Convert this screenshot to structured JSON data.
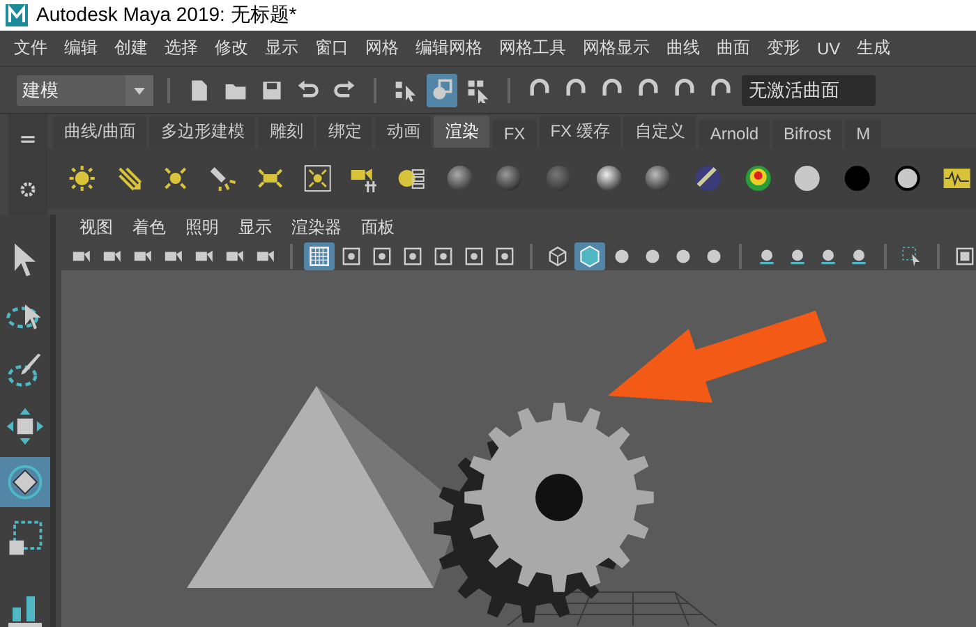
{
  "window": {
    "title": "Autodesk Maya 2019: 无标题*"
  },
  "menu_bar": [
    "文件",
    "编辑",
    "创建",
    "选择",
    "修改",
    "显示",
    "窗口",
    "网格",
    "编辑网格",
    "网格工具",
    "网格显示",
    "曲线",
    "曲面",
    "变形",
    "UV",
    "生成"
  ],
  "status_line": {
    "mode": {
      "value": "建模"
    },
    "select_tools": [
      {
        "kind": "hierarchy",
        "selected": false
      },
      {
        "kind": "object",
        "selected": true
      },
      {
        "kind": "component",
        "selected": false
      }
    ],
    "live_surface": {
      "value": "无激活曲面"
    }
  },
  "shelf_tabs": [
    {
      "label": "曲线/曲面",
      "selected": false
    },
    {
      "label": "多边形建模",
      "selected": false
    },
    {
      "label": "雕刻",
      "selected": false
    },
    {
      "label": "绑定",
      "selected": false
    },
    {
      "label": "动画",
      "selected": false
    },
    {
      "label": "渲染",
      "selected": true
    },
    {
      "label": "FX",
      "selected": false
    },
    {
      "label": "FX 缓存",
      "selected": false
    },
    {
      "label": "自定义",
      "selected": false
    },
    {
      "label": "Arnold",
      "selected": false
    },
    {
      "label": "Bifrost",
      "selected": false
    },
    {
      "label": "M",
      "selected": false
    }
  ],
  "toolbox": [
    {
      "kind": "select",
      "selected": false
    },
    {
      "kind": "lasso",
      "selected": false
    },
    {
      "kind": "paint",
      "selected": false
    },
    {
      "kind": "move",
      "selected": false
    },
    {
      "kind": "rotate",
      "selected": true
    },
    {
      "kind": "scale",
      "selected": false
    }
  ],
  "panel": {
    "menu": [
      "视图",
      "着色",
      "照明",
      "显示",
      "渲染器",
      "面板"
    ],
    "toggles": [
      {
        "kind": "grid",
        "selected": true
      },
      {
        "kind": "shaded",
        "selected": true
      }
    ]
  }
}
